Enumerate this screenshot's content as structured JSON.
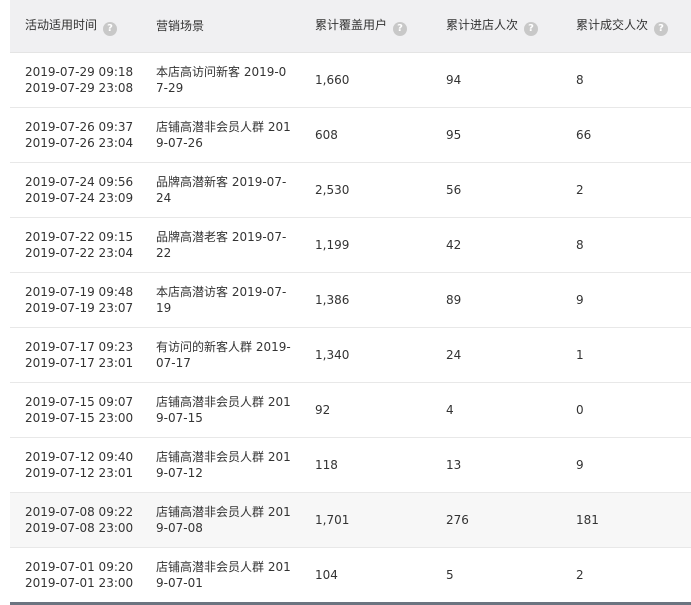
{
  "table": {
    "headers": [
      {
        "label": "活动适用时间",
        "help": "?"
      },
      {
        "label": "营销场景",
        "help": ""
      },
      {
        "label": "累计覆盖用户",
        "help": "?"
      },
      {
        "label": "累计进店人次",
        "help": "?"
      },
      {
        "label": "累计成交人次",
        "help": "?"
      }
    ],
    "rows": [
      {
        "start": "2019-07-29 09:18",
        "end": "2019-07-29 23:08",
        "scene": "本店高访问新客 2019-07-29",
        "users": "1,660",
        "visits": "94",
        "deals": "8"
      },
      {
        "start": "2019-07-26 09:37",
        "end": "2019-07-26 23:04",
        "scene": "店铺高潜非会员人群 2019-07-26",
        "users": "608",
        "visits": "95",
        "deals": "66"
      },
      {
        "start": "2019-07-24 09:56",
        "end": "2019-07-24 23:09",
        "scene": "品牌高潜新客 2019-07-24",
        "users": "2,530",
        "visits": "56",
        "deals": "2"
      },
      {
        "start": "2019-07-22 09:15",
        "end": "2019-07-22 23:04",
        "scene": "品牌高潜老客 2019-07-22",
        "users": "1,199",
        "visits": "42",
        "deals": "8"
      },
      {
        "start": "2019-07-19 09:48",
        "end": "2019-07-19 23:07",
        "scene": "本店高潜访客 2019-07-19",
        "users": "1,386",
        "visits": "89",
        "deals": "9"
      },
      {
        "start": "2019-07-17 09:23",
        "end": "2019-07-17 23:01",
        "scene": "有访问的新客人群 2019-07-17",
        "users": "1,340",
        "visits": "24",
        "deals": "1"
      },
      {
        "start": "2019-07-15 09:07",
        "end": "2019-07-15 23:00",
        "scene": "店铺高潜非会员人群 2019-07-15",
        "users": "92",
        "visits": "4",
        "deals": "0"
      },
      {
        "start": "2019-07-12 09:40",
        "end": "2019-07-12 23:01",
        "scene": "店铺高潜非会员人群 2019-07-12",
        "users": "118",
        "visits": "13",
        "deals": "9"
      },
      {
        "start": "2019-07-08 09:22",
        "end": "2019-07-08 23:00",
        "scene": "店铺高潜非会员人群 2019-07-08",
        "users": "1,701",
        "visits": "276",
        "deals": "181"
      },
      {
        "start": "2019-07-01 09:20",
        "end": "2019-07-01 23:00",
        "scene": "店铺高潜非会员人群 2019-07-01",
        "users": "104",
        "visits": "5",
        "deals": "2"
      }
    ]
  },
  "colors": {
    "header_bg": "#f0f0f2",
    "row_highlight": "#f7f7f7",
    "help_icon": "#c8c8c8",
    "text": "#333333"
  }
}
